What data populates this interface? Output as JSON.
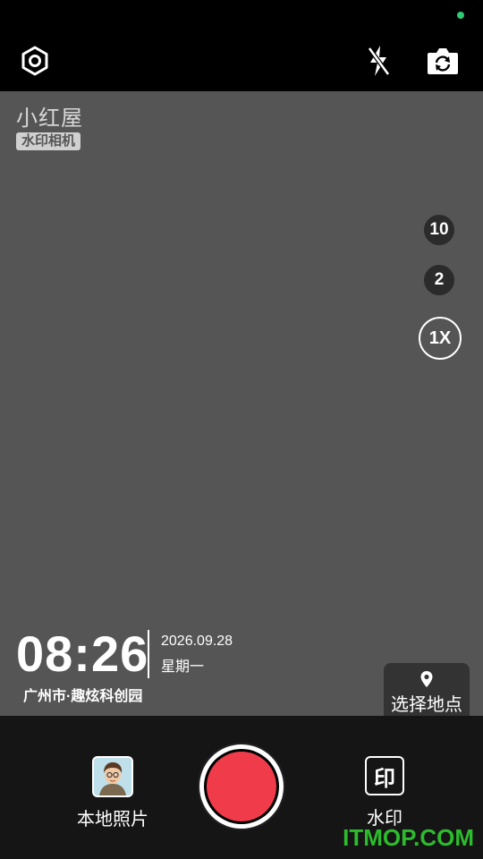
{
  "brand": {
    "logo": "小红屋",
    "tag": "水印相机"
  },
  "topbar": {
    "settings_icon": "settings-hexagon-icon",
    "flash_icon": "flash-off-icon",
    "switch_icon": "camera-switch-icon"
  },
  "zoom": {
    "options": [
      "10",
      "2",
      "1X"
    ],
    "selected": "1X"
  },
  "watermark": {
    "time": "08:26",
    "date": "2026.09.28",
    "weekday": "星期一",
    "location": "广州市·趣炫科创园"
  },
  "location_button": {
    "label": "选择地点",
    "icon": "location-pin-icon"
  },
  "bottom": {
    "album_label": "本地照片",
    "watermark_label": "水印",
    "watermark_icon_text": "印"
  },
  "site_watermark": "ITMOP.COM",
  "colors": {
    "shutter": "#ef3b4a",
    "viewfinder": "#555555",
    "status_dot": "#2ecc71"
  }
}
